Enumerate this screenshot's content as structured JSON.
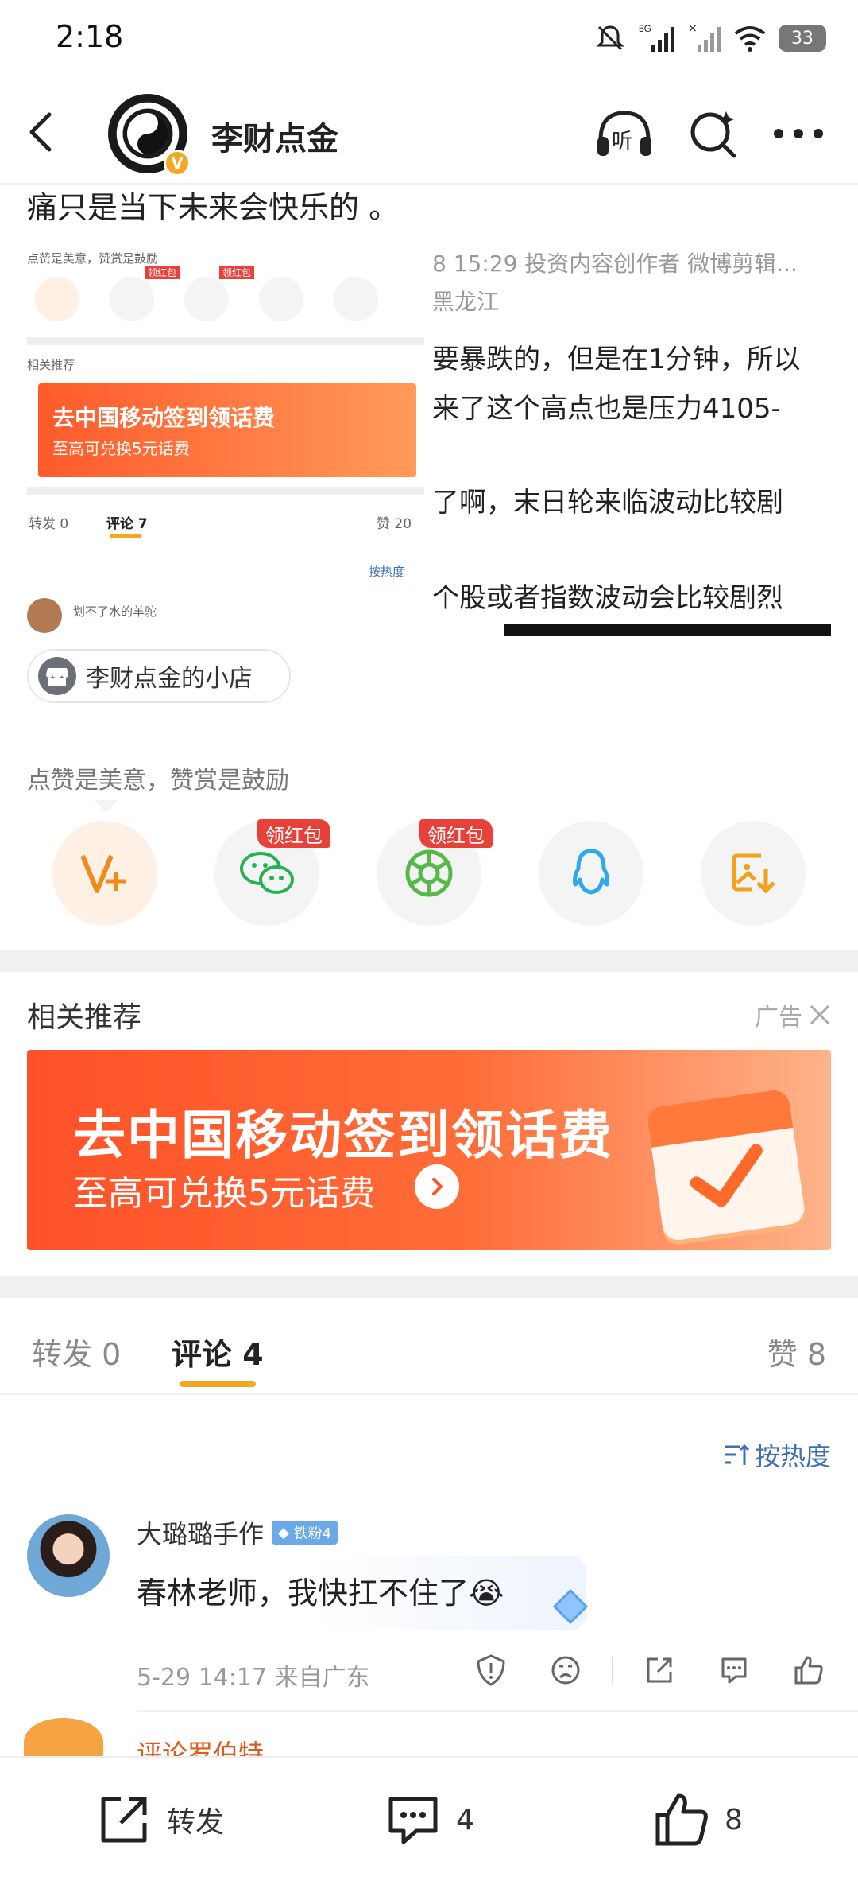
{
  "status_bar": {
    "time": "2:18",
    "network": "5G",
    "battery": "33"
  },
  "header": {
    "account_name": "李财点金",
    "verified_badge": "V",
    "listen_label": "听"
  },
  "post": {
    "text_tail": "痛只是当下未来会快乐的 。"
  },
  "embedded_screenshot": {
    "caption": "点赞是美意，赞赏是鼓励",
    "redpack_1": "领红包",
    "redpack_2": "领红包",
    "related": "相关推荐",
    "banner_title": "去中国移动签到领话费",
    "banner_sub": "至高可兑换5元话费",
    "tab_repost": "转发 0",
    "tab_comment": "评论 7",
    "tab_like": "赞 20",
    "sort": "按热度",
    "commenter": "划不了水的羊驼",
    "right_lines": [
      "8 15:29  投资内容创作者 微博剪辑...",
      "黑龙江",
      "要暴跌的，但是在1分钟，所以",
      "来了这个高点也是压力4105-",
      "了啊，末日轮来临波动比较剧",
      "个股或者指数波动会比较剧烈"
    ]
  },
  "shop": {
    "label": "李财点金的小店"
  },
  "reward": {
    "caption": "点赞是美意，赞赏是鼓励",
    "buttons": [
      {
        "icon": "v-plus-icon"
      },
      {
        "icon": "wechat-icon",
        "badge": "领红包"
      },
      {
        "icon": "moments-icon",
        "badge": "领红包"
      },
      {
        "icon": "qq-icon"
      },
      {
        "icon": "save-image-icon"
      }
    ]
  },
  "related": {
    "title": "相关推荐",
    "ad_label": "广告"
  },
  "banner": {
    "title": "去中国移动签到领话费",
    "subtitle": "至高可兑换5元话费"
  },
  "tabs": {
    "repost": "转发 0",
    "comment": "评论 4",
    "like": "赞 8"
  },
  "sort": {
    "label": "按热度"
  },
  "comments": [
    {
      "user": "大璐璐手作",
      "badge": "铁粉4",
      "text": "春林老师，我快扛不住了😭",
      "meta": "5-29 14:17  来自广东"
    },
    {
      "user": "评论罗伯特"
    }
  ],
  "bottom_bar": {
    "repost": "转发",
    "comment": "4",
    "like": "8"
  },
  "colors": {
    "accent": "#f5a623",
    "link": "#3d6fb3",
    "redpack": "#e8413a",
    "banner": "#ff5128"
  }
}
